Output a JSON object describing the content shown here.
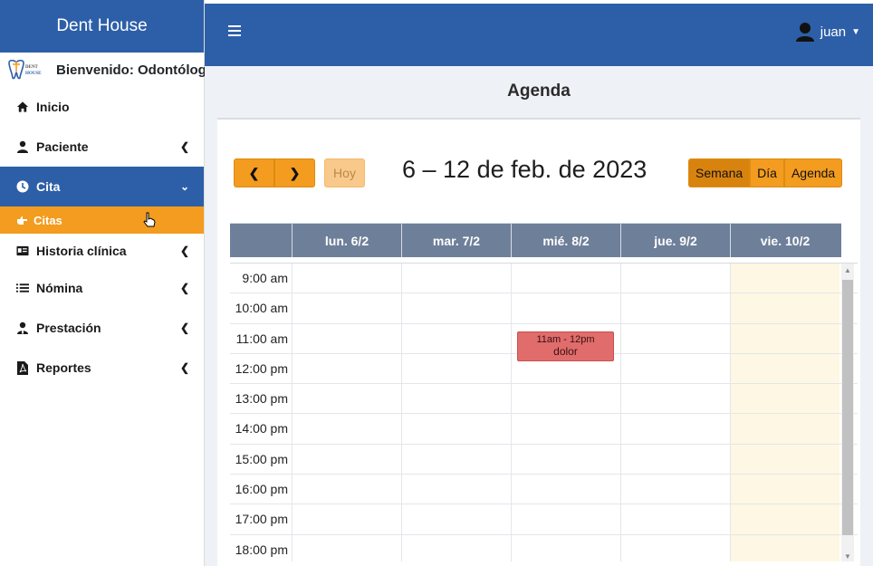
{
  "sidebar": {
    "brand": "Dent House",
    "welcome": "Bienvenido: Odontólogo",
    "items": [
      {
        "label": "Inicio",
        "icon": "home-icon"
      },
      {
        "label": "Paciente",
        "icon": "user-icon"
      },
      {
        "label": "Cita",
        "icon": "clock-icon"
      },
      {
        "label": "Historia clínica",
        "icon": "id-card-icon"
      },
      {
        "label": "Nómina",
        "icon": "list-icon"
      },
      {
        "label": "Prestación",
        "icon": "user-tie-icon"
      },
      {
        "label": "Reportes",
        "icon": "pdf-file-icon"
      }
    ],
    "submenu_citas": "Citas"
  },
  "topbar": {
    "username": "juan"
  },
  "page": {
    "title": "Agenda"
  },
  "calendar": {
    "today_label": "Hoy",
    "range_title": "6 – 12 de feb. de 2023",
    "views": [
      "Semana",
      "Día",
      "Agenda"
    ],
    "active_view": "Semana",
    "days": [
      "lun. 6/2",
      "mar. 7/2",
      "mié. 8/2",
      "jue. 9/2",
      "vie. 10/2"
    ],
    "today_day": "vie. 10/2",
    "times": [
      "9:00 am",
      "10:00 am",
      "11:00 am",
      "12:00 pm",
      "13:00 pm",
      "14:00 pm",
      "15:00 pm",
      "16:00 pm",
      "17:00 pm",
      "18:00 pm"
    ],
    "event": {
      "time": "11am - 12pm",
      "title": "dolor",
      "day": "mié. 8/2",
      "color": "#e06c6c"
    }
  },
  "colors": {
    "primary": "#2d5fa8",
    "accent": "#f39c1f",
    "header_gray": "#6e7f99",
    "today_bg": "#fdf7e3"
  }
}
